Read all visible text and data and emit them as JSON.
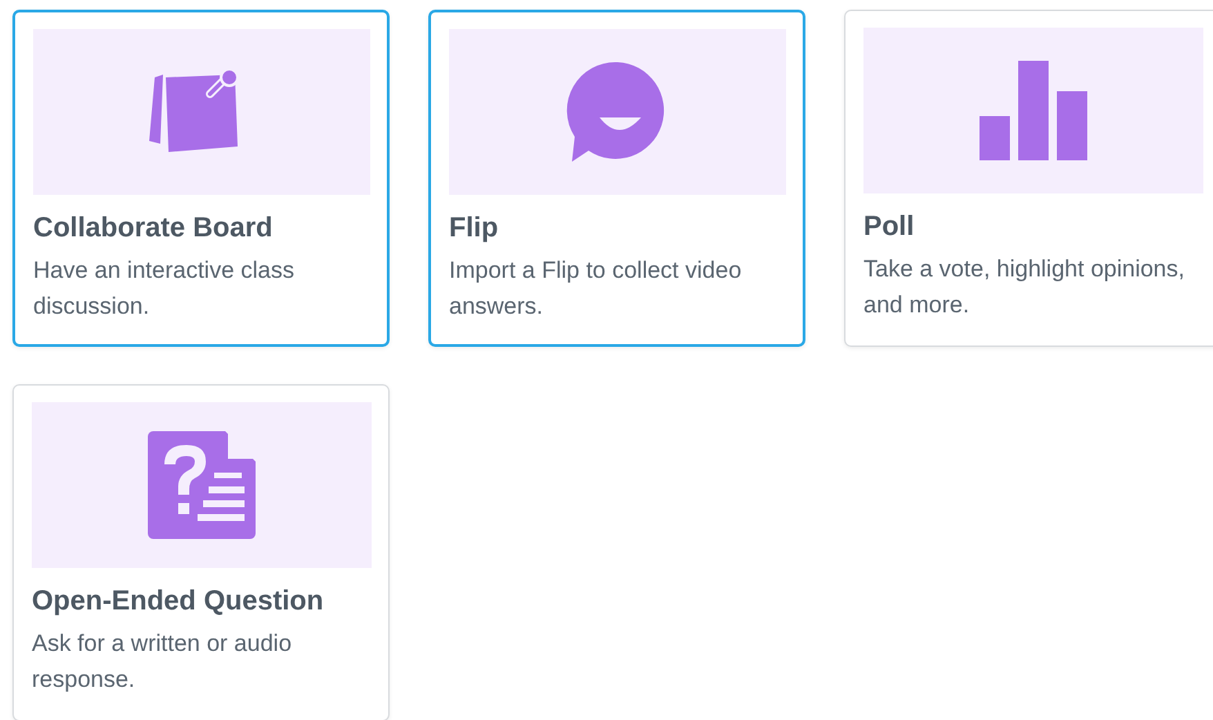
{
  "cards": [
    {
      "kind": "board",
      "title": "Collaborate Board",
      "description": "Have an interactive class discussion.",
      "selected": true
    },
    {
      "kind": "flip",
      "title": "Flip",
      "description": "Import a Flip to collect video answers.",
      "selected": true
    },
    {
      "kind": "poll",
      "title": "Poll",
      "description": "Take a vote, highlight opinions, and more.",
      "selected": false
    },
    {
      "kind": "question",
      "title": "Open-Ended Question",
      "description": "Ask for a written or audio response.",
      "selected": false
    }
  ]
}
